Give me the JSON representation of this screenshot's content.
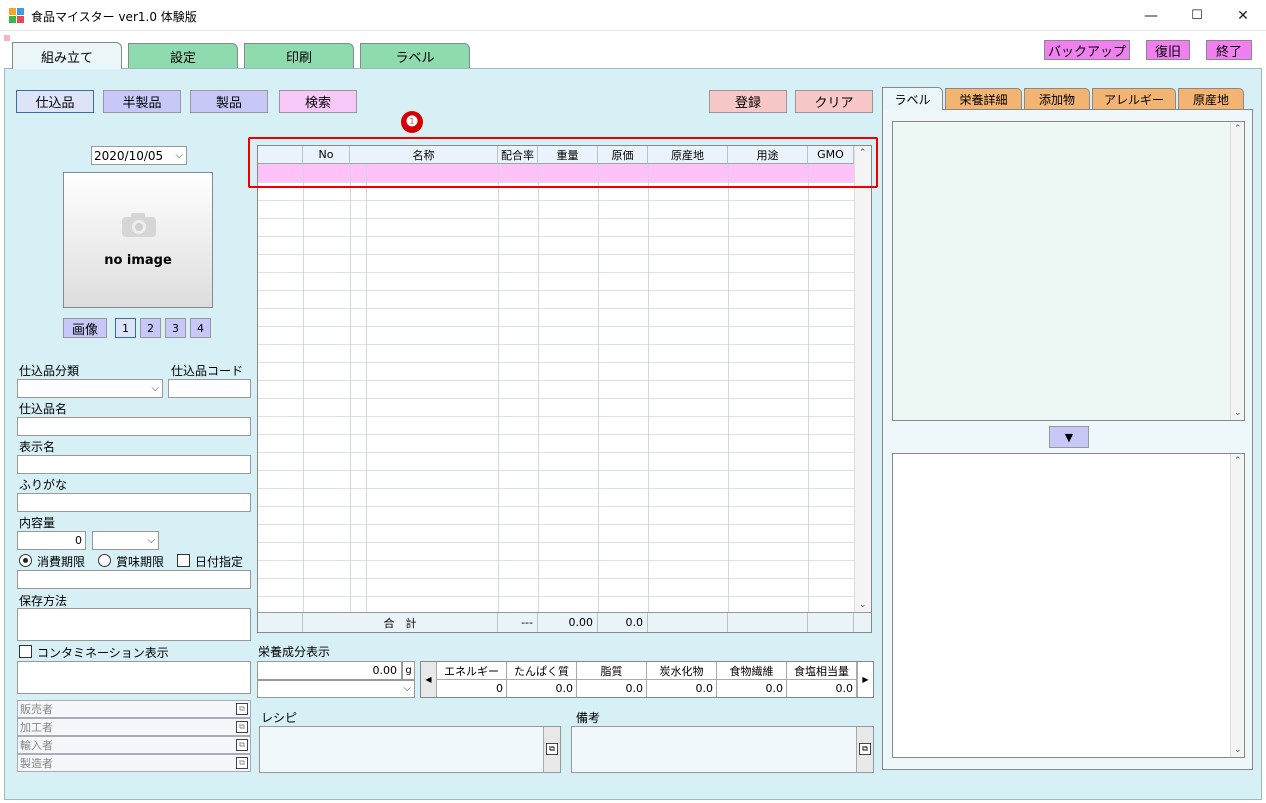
{
  "window": {
    "title": "食品マイスター ver1.0 体験版",
    "minimize": "—",
    "maximize": "☐",
    "close": "✕"
  },
  "main_tabs": [
    "組み立て",
    "設定",
    "印刷",
    "ラベル"
  ],
  "top_buttons": {
    "backup": "バックアップ",
    "restore": "復旧",
    "exit": "終了"
  },
  "category_buttons": [
    "仕込品",
    "半製品",
    "製品",
    "検索"
  ],
  "action_buttons": {
    "register": "登録",
    "clear": "クリア"
  },
  "left": {
    "date": "2020/10/05",
    "no_image": "no image",
    "image_button": "画像",
    "image_pages": [
      "1",
      "2",
      "3",
      "4"
    ],
    "category_label": "仕込品分類",
    "code_label": "仕込品コード",
    "name_label": "仕込品名",
    "display_name_label": "表示名",
    "furigana_label": "ふりがな",
    "content_label": "内容量",
    "content_value": "0",
    "expiry_consume": "消費期限",
    "expiry_best": "賞味期限",
    "date_specify": "日付指定",
    "storage_label": "保存方法",
    "contamination_label": "コンタミネーション表示",
    "parties": [
      "販売者",
      "加工者",
      "輸入者",
      "製造者"
    ]
  },
  "grid": {
    "headers": [
      "No",
      "名称",
      "配合率",
      "重量",
      "原価",
      "原産地",
      "用途",
      "GMO"
    ],
    "footer_label": "合　計",
    "footer_ratio": "---",
    "footer_weight": "0.00",
    "footer_cost": "0.0"
  },
  "marker": "❶",
  "nutrition": {
    "title": "栄養成分表示",
    "amount": "0.00",
    "unit": "g",
    "headers": [
      "エネルギー",
      "たんぱく質",
      "脂質",
      "炭水化物",
      "食物繊維",
      "食塩相当量"
    ],
    "values": [
      "0",
      "0.0",
      "0.0",
      "0.0",
      "0.0",
      "0.0"
    ]
  },
  "recipe_label": "レシピ",
  "notes_label": "備考",
  "right_tabs": [
    "ラベル",
    "栄養詳細",
    "添加物",
    "アレルギー",
    "原産地"
  ],
  "colors": {
    "panel": "#d6f0f6",
    "tab_green": "#8fdbb0",
    "tab_orange": "#f4b471",
    "magenta_button": "#f080f0",
    "highlight": "#e00000"
  }
}
